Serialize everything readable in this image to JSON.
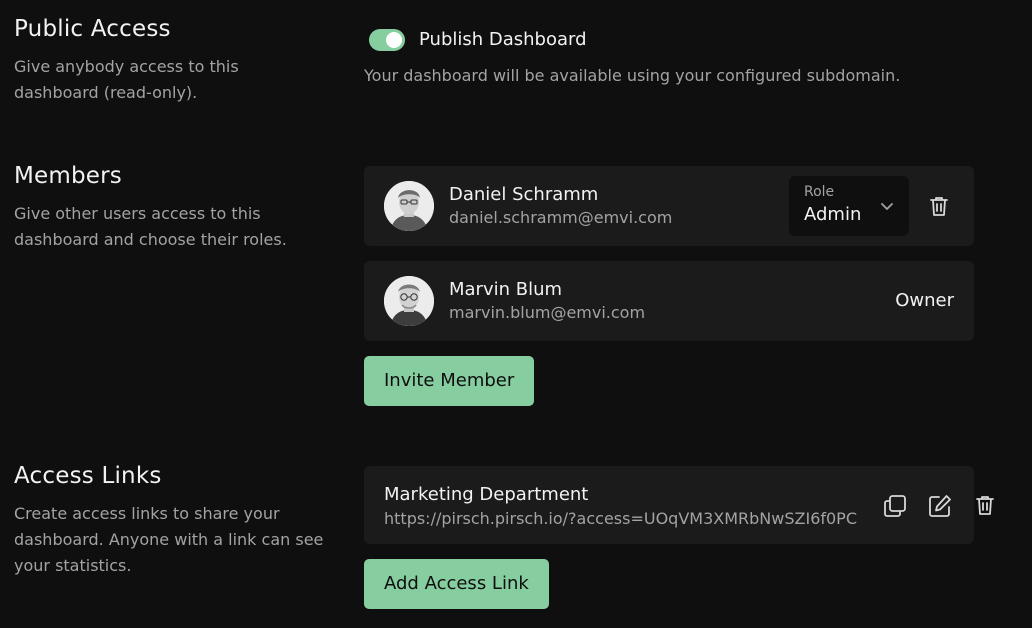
{
  "public_access": {
    "title": "Public Access",
    "description": "Give anybody access to this dashboard (read-only).",
    "toggle_label": "Publish Dashboard",
    "toggle_on": true,
    "hint": "Your dashboard will be available using your configured subdomain."
  },
  "members": {
    "title": "Members",
    "description": "Give other users access to this dashboard and choose their roles.",
    "list": [
      {
        "name": "Daniel Schramm",
        "email": "daniel.schramm@emvi.com",
        "role_caption": "Role",
        "role": "Admin"
      },
      {
        "name": "Marvin Blum",
        "email": "marvin.blum@emvi.com",
        "role": "Owner"
      }
    ],
    "invite_button": "Invite Member"
  },
  "access_links": {
    "title": "Access Links",
    "description": "Create access links to share your dashboard. Anyone with a link can see your statistics.",
    "list": [
      {
        "name": "Marketing Department",
        "url": "https://pirsch.pirsch.io/?access=UOqVM3XMRbNwSZI6f0PC"
      }
    ],
    "add_button": "Add Access Link"
  },
  "icons": {
    "toggle": "toggle-icon",
    "chevron": "chevron-down-icon",
    "trash": "trash-icon",
    "copy": "copy-icon",
    "edit": "edit-icon",
    "avatar": "user-avatar"
  },
  "colors": {
    "background": "#0f0f0f",
    "card": "#1b1b1b",
    "accent": "#86cd9f",
    "text": "#f2f2f2",
    "muted": "#a3a3a3"
  }
}
